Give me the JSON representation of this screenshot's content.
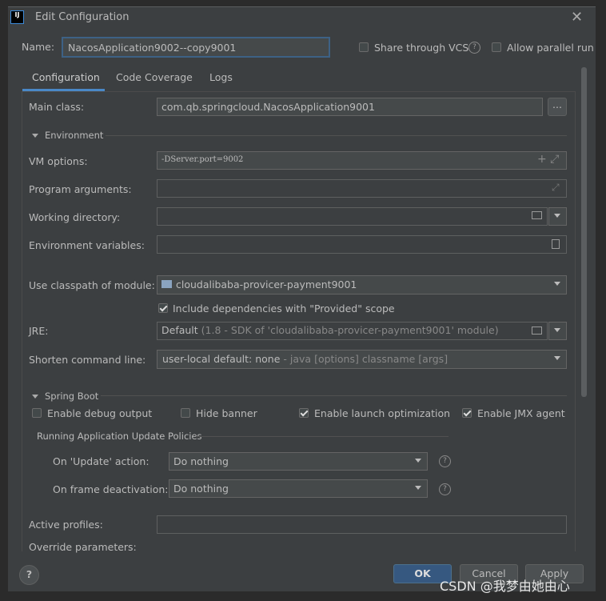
{
  "window": {
    "title": "Edit Configuration",
    "app_icon": "intellij-icon"
  },
  "name_label": "Name:",
  "name_value": "NacosApplication9002--copy9001",
  "share_vcs": {
    "label": "Share through VCS",
    "checked": false
  },
  "allow_parallel": {
    "label": "Allow parallel run",
    "checked": false
  },
  "tabs": [
    {
      "label": "Configuration",
      "active": true
    },
    {
      "label": "Code Coverage"
    },
    {
      "label": "Logs"
    }
  ],
  "main_class": {
    "label": "Main class:",
    "value": "com.qb.springcloud.NacosApplication9001",
    "browse": "..."
  },
  "environment": {
    "title": "Environment",
    "vm_options": {
      "label": "VM options:",
      "value": "-DServer.port=9002"
    },
    "program_arguments": {
      "label": "Program arguments:",
      "value": ""
    },
    "working_directory": {
      "label": "Working directory:",
      "value": ""
    },
    "environment_variables": {
      "label": "Environment variables:",
      "value": ""
    }
  },
  "classpath": {
    "label": "Use classpath of module:",
    "value": "cloudalibaba-provicer-payment9001"
  },
  "include_provided": {
    "label": "Include dependencies with \"Provided\" scope",
    "checked": true
  },
  "jre": {
    "label": "JRE:",
    "value": "Default",
    "hint": "(1.8 - SDK of 'cloudalibaba-provicer-payment9001' module)"
  },
  "shorten": {
    "label": "Shorten command line:",
    "value": "user-local default: none",
    "hint": "- java [options] classname [args]"
  },
  "spring_boot": {
    "title": "Spring Boot",
    "options": [
      {
        "label": "Enable debug output",
        "checked": false
      },
      {
        "label": "Hide banner",
        "checked": false
      },
      {
        "label": "Enable launch optimization",
        "checked": true
      },
      {
        "label": "Enable JMX agent",
        "checked": true
      }
    ],
    "policies_title": "Running Application Update Policies",
    "update_action": {
      "label": "On 'Update' action:",
      "value": "Do nothing"
    },
    "frame_deactivation": {
      "label": "On frame deactivation:",
      "value": "Do nothing"
    },
    "active_profiles": {
      "label": "Active profiles:",
      "value": ""
    },
    "override_parameters": {
      "label": "Override parameters:"
    }
  },
  "buttons": {
    "help": "?",
    "ok": "OK",
    "cancel": "Cancel",
    "apply": "Apply"
  },
  "watermark": "CSDN @我梦由她由心"
}
